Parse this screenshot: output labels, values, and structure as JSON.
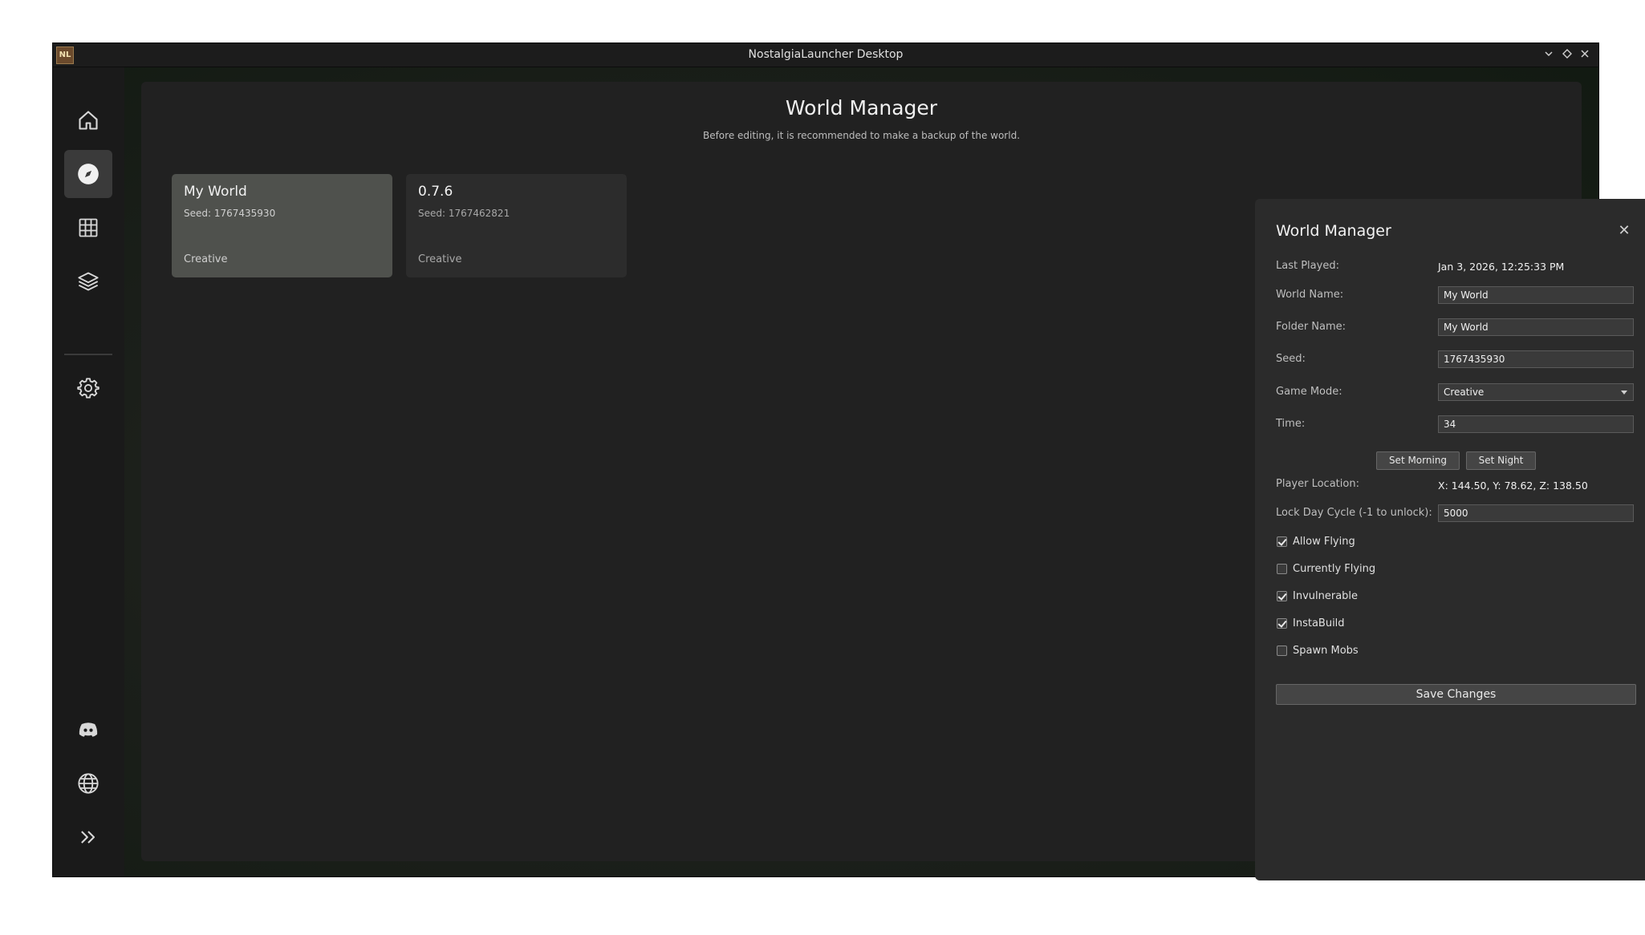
{
  "window": {
    "app_icon_text": "NL",
    "title": "NostalgiaLauncher Desktop"
  },
  "sidebar": {
    "items": [
      {
        "icon": "home-icon",
        "active": false
      },
      {
        "icon": "compass-icon",
        "active": true
      },
      {
        "icon": "grid-icon",
        "active": false
      },
      {
        "icon": "layers-icon",
        "active": false
      },
      {
        "icon": "gear-icon",
        "active": false
      },
      {
        "icon": "discord-icon",
        "active": false
      },
      {
        "icon": "globe-icon",
        "active": false
      },
      {
        "icon": "double-chevron-right-icon",
        "active": false
      }
    ]
  },
  "page": {
    "title": "World Manager",
    "subtitle": "Before editing, it is recommended to make a backup of the world."
  },
  "worlds": [
    {
      "name": "My World",
      "seed": "Seed: 1767435930",
      "mode": "Creative",
      "selected": true
    },
    {
      "name": "0.7.6",
      "seed": "Seed: 1767462821",
      "mode": "Creative",
      "selected": false
    }
  ],
  "panel": {
    "title": "World Manager",
    "last_played_label": "Last Played:",
    "last_played_value": "Jan 3, 2026, 12:25:33 PM",
    "world_name_label": "World Name:",
    "world_name_value": "My World",
    "folder_name_label": "Folder Name:",
    "folder_name_value": "My World",
    "seed_label": "Seed:",
    "seed_value": "1767435930",
    "game_mode_label": "Game Mode:",
    "game_mode_value": "Creative",
    "time_label": "Time:",
    "time_value": "34",
    "set_morning_label": "Set Morning",
    "set_night_label": "Set Night",
    "player_location_label": "Player Location:",
    "player_location_value": "X: 144.50, Y: 78.62, Z: 138.50",
    "lock_day_cycle_label": "Lock Day Cycle (-1 to unlock):",
    "lock_day_cycle_value": "5000",
    "checkboxes": [
      {
        "label": "Allow Flying",
        "checked": true
      },
      {
        "label": "Currently Flying",
        "checked": false
      },
      {
        "label": "Invulnerable",
        "checked": true
      },
      {
        "label": "InstaBuild",
        "checked": true
      },
      {
        "label": "Spawn Mobs",
        "checked": false
      }
    ],
    "save_label": "Save Changes"
  }
}
